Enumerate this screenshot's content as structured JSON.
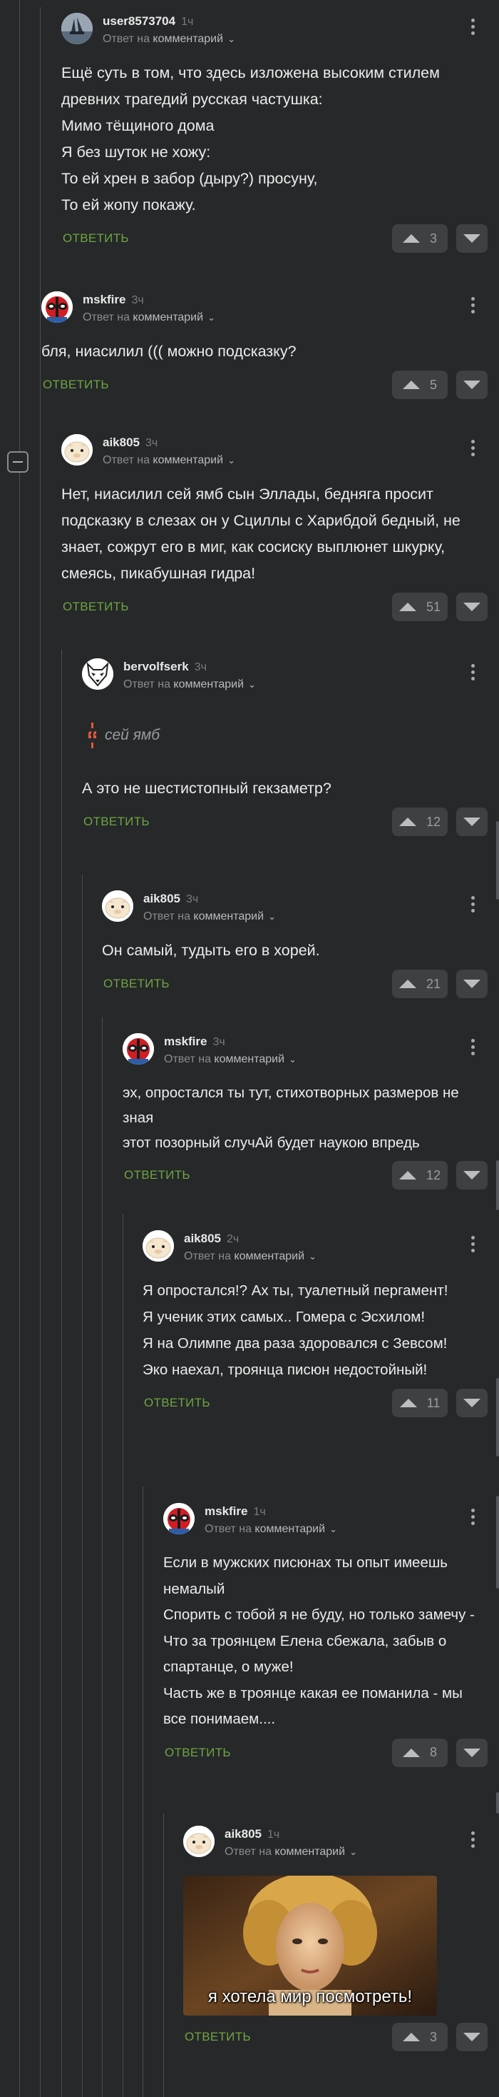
{
  "reply_prefix": "Ответ на",
  "reply_target": "комментарий",
  "answer_label": "ОТВЕТИТЬ",
  "comments": [
    {
      "user": "user8573704",
      "time": "1ч",
      "avatar": "ship",
      "text": "Ещё суть в том, что здесь изложена высоким стилем древних трагедий русская частушка:\nМимо тёщиного дома\nЯ без шуток не хожу:\nТо ей хрен в забор (дыру?) просуну,\nТо ей жопу покажу.",
      "rating": "3"
    },
    {
      "user": "mskfire",
      "time": "3ч",
      "avatar": "deadpool",
      "text": "бля, ниасилил ((( можно подсказку?",
      "rating": "5"
    },
    {
      "user": "aik805",
      "time": "3ч",
      "avatar": "pig",
      "text": "Нет, ниасилил сей ямб сын Эллады, бедняга просит подсказку в слезах он у Сциллы с Харибдой бедный, не знает, сожрут его в миг, как сосиску выплюнет шкурку, смеясь, пикабушная гидра!",
      "rating": "51"
    },
    {
      "user": "bervolfserk",
      "time": "3ч",
      "avatar": "wolf",
      "quote": "сей ямб",
      "text": "А это не шестистопный гекзаметр?",
      "rating": "12"
    },
    {
      "user": "aik805",
      "time": "3ч",
      "avatar": "pig",
      "text": "Он самый, тудыть его в хорей.",
      "rating": "21"
    },
    {
      "user": "mskfire",
      "time": "3ч",
      "avatar": "deadpool",
      "text": "эх, опростался ты тут, стихотворных размеров не зная\nэтот позорный случАй будет наукою впредь",
      "rating": "12"
    },
    {
      "user": "aik805",
      "time": "2ч",
      "avatar": "pig",
      "text": "Я опростался!? Ах ты, туалетный пергамент!\nЯ ученик этих самых.. Гомера с Эсхилом!\nЯ на Олимпе два раза здоровался с Зевсом!\nЭко наехал, троянца писюн недостойный!",
      "rating": "11"
    },
    {
      "user": "mskfire",
      "time": "1ч",
      "avatar": "deadpool",
      "text": "Если в мужских писюнах ты опыт имеешь немалый\nСпорить с тобой я не буду, но только замечу -\nЧто за троянцем Елена сбежала, забыв о спартанце, о муже!\nЧасть же в троянце какая ее поманила - мы все понимаем....",
      "rating": "8"
    },
    {
      "user": "aik805",
      "time": "1ч",
      "avatar": "pig",
      "meme_caption": "я хотела мир посмотреть!",
      "rating": "3"
    }
  ]
}
